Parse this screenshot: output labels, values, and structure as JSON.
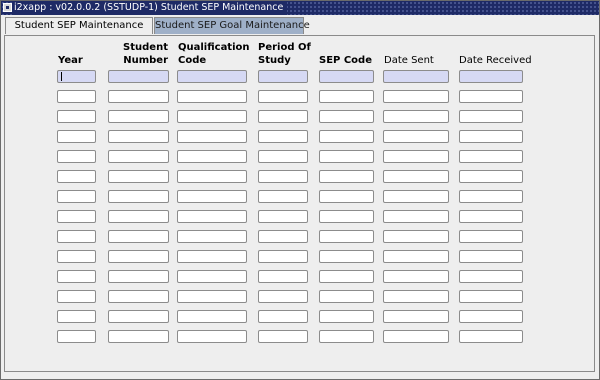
{
  "window": {
    "title": "i2xapp : v02.0.0.2 (SSTUDP-1) Student SEP Maintenance"
  },
  "tabs": [
    {
      "label": "Student SEP Maintenance",
      "active": true
    },
    {
      "label": "Student SEP Goal Maintenance",
      "active": false
    }
  ],
  "grid": {
    "columns": [
      {
        "key": "year",
        "label_line1": "",
        "label_line2": "Year"
      },
      {
        "key": "student_number",
        "label_line1": "Student",
        "label_line2": "Number"
      },
      {
        "key": "qualification_code",
        "label_line1": "Qualification",
        "label_line2": "Code"
      },
      {
        "key": "period_of_study",
        "label_line1": "Period Of",
        "label_line2": "Study"
      },
      {
        "key": "sep_code",
        "label_line1": "",
        "label_line2": "SEP Code"
      },
      {
        "key": "date_sent",
        "label_line1": "",
        "label_line2": "Date Sent"
      },
      {
        "key": "date_received",
        "label_line1": "",
        "label_line2": "Date Received"
      }
    ],
    "rows": [
      [
        "",
        "",
        "",
        "",
        "",
        "",
        ""
      ],
      [
        "",
        "",
        "",
        "",
        "",
        "",
        ""
      ],
      [
        "",
        "",
        "",
        "",
        "",
        "",
        ""
      ],
      [
        "",
        "",
        "",
        "",
        "",
        "",
        ""
      ],
      [
        "",
        "",
        "",
        "",
        "",
        "",
        ""
      ],
      [
        "",
        "",
        "",
        "",
        "",
        "",
        ""
      ],
      [
        "",
        "",
        "",
        "",
        "",
        "",
        ""
      ],
      [
        "",
        "",
        "",
        "",
        "",
        "",
        ""
      ],
      [
        "",
        "",
        "",
        "",
        "",
        "",
        ""
      ],
      [
        "",
        "",
        "",
        "",
        "",
        "",
        ""
      ],
      [
        "",
        "",
        "",
        "",
        "",
        "",
        ""
      ],
      [
        "",
        "",
        "",
        "",
        "",
        "",
        ""
      ],
      [
        "",
        "",
        "",
        "",
        "",
        "",
        ""
      ],
      [
        "",
        "",
        "",
        "",
        "",
        "",
        ""
      ]
    ],
    "current_record_color": "#d6d9f4",
    "field_color": "#ffffff"
  },
  "colors": {
    "titlebar": "#1e2a66",
    "inactive_tab": "#9fb0c8",
    "canvas": "#eeeeee"
  }
}
